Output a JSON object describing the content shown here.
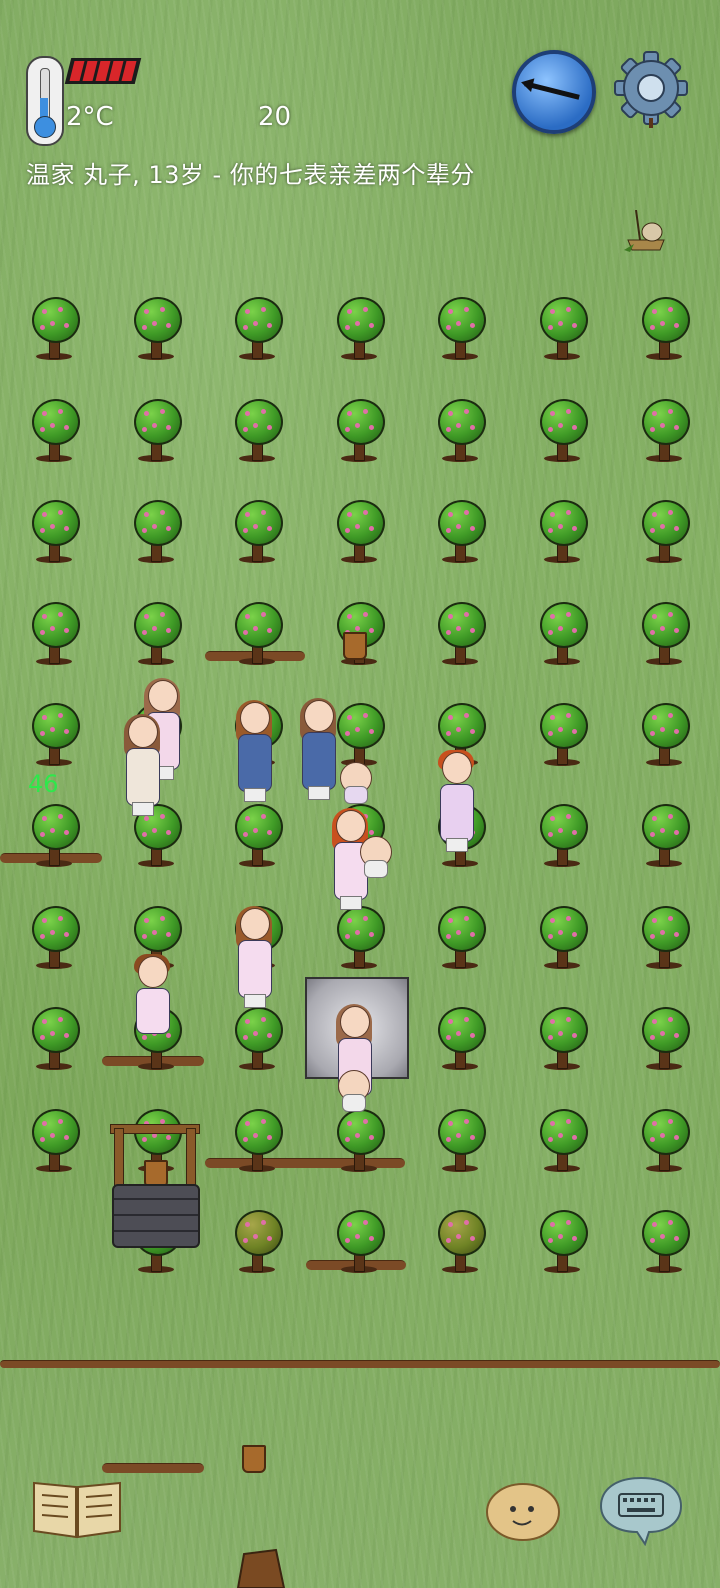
{
  "hud": {
    "temperature": "2°C",
    "counter": "20",
    "status_line": "温家 丸子, 13岁 - 你的七表亲差两个辈分",
    "floating_number": "46",
    "health_segments": 5
  },
  "icons": {
    "thermometer": "thermometer-icon",
    "compass": "compass-icon",
    "settings": "gear-icon",
    "book": "book-icon",
    "emote": "potato-face-icon",
    "keyboard": "keyboard-icon"
  },
  "colors": {
    "grass": "#7fa95f",
    "health": "#d8262a",
    "floating_number": "#2ee84b",
    "text": "#ffffff"
  }
}
